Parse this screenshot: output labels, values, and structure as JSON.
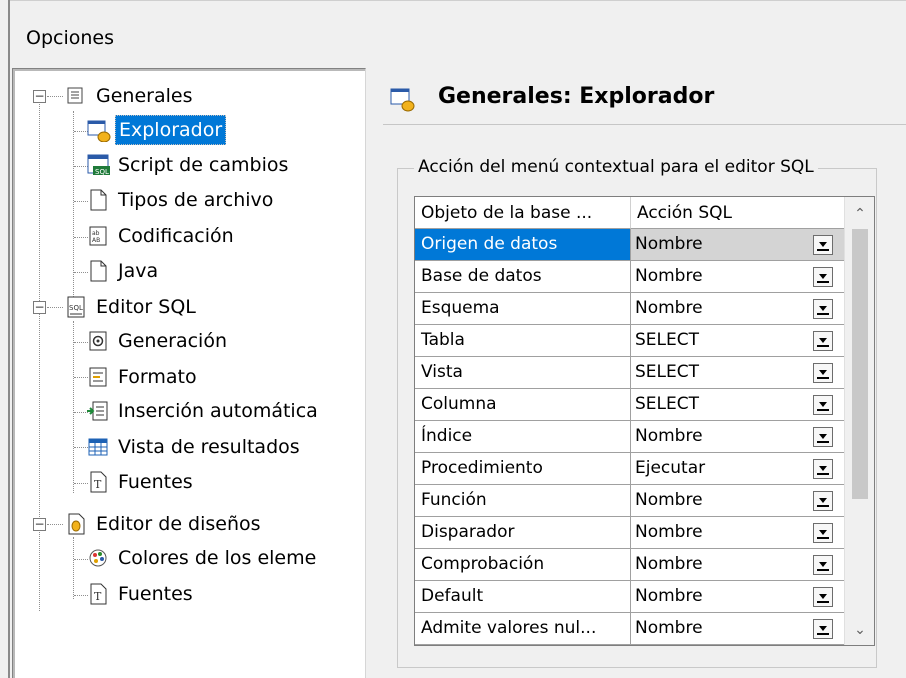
{
  "window": {
    "title": "Opciones"
  },
  "tree": {
    "nodes": [
      {
        "label": "Generales",
        "icon": "window-icon",
        "level": 0,
        "expanded": true,
        "selected": false
      },
      {
        "label": "Explorador",
        "icon": "explorer-db-icon",
        "level": 1,
        "selected": true
      },
      {
        "label": "Script de cambios",
        "icon": "sql-script-icon",
        "level": 1,
        "selected": false
      },
      {
        "label": "Tipos de archivo",
        "icon": "file-icon",
        "level": 1,
        "selected": false
      },
      {
        "label": "Codificación",
        "icon": "encoding-icon",
        "level": 1,
        "selected": false
      },
      {
        "label": "Java",
        "icon": "file-icon",
        "level": 1,
        "selected": false
      },
      {
        "label": "Editor SQL",
        "icon": "sql-editor-icon",
        "level": 0,
        "expanded": true,
        "selected": false
      },
      {
        "label": "Generación",
        "icon": "gear-doc-icon",
        "level": 1,
        "selected": false
      },
      {
        "label": "Formato",
        "icon": "format-icon",
        "level": 1,
        "selected": false
      },
      {
        "label": "Inserción automática",
        "icon": "insert-icon",
        "level": 1,
        "selected": false
      },
      {
        "label": "Vista de resultados",
        "icon": "table-grid-icon",
        "level": 1,
        "selected": false
      },
      {
        "label": "Fuentes",
        "icon": "font-icon",
        "level": 1,
        "selected": false
      },
      {
        "label": "Editor de diseños",
        "icon": "design-editor-icon",
        "level": 0,
        "expanded": true,
        "selected": false
      },
      {
        "label": "Colores de los eleme",
        "icon": "palette-icon",
        "level": 1,
        "selected": false
      },
      {
        "label": "Fuentes",
        "icon": "font-icon",
        "level": 1,
        "selected": false
      }
    ]
  },
  "content": {
    "title": "Generales: Explorador",
    "group_label": "Acción del menú contextual para el editor SQL",
    "grid": {
      "headers": [
        "Objeto de la base ...",
        "Acción SQL"
      ],
      "rows": [
        {
          "object": "Origen de datos",
          "action": "Nombre",
          "selected": true
        },
        {
          "object": "Base de datos",
          "action": "Nombre"
        },
        {
          "object": "Esquema",
          "action": "Nombre"
        },
        {
          "object": "Tabla",
          "action": "SELECT"
        },
        {
          "object": "Vista",
          "action": "SELECT"
        },
        {
          "object": "Columna",
          "action": "SELECT"
        },
        {
          "object": "Índice",
          "action": "Nombre"
        },
        {
          "object": "Procedimiento",
          "action": "Ejecutar"
        },
        {
          "object": "Función",
          "action": "Nombre"
        },
        {
          "object": "Disparador",
          "action": "Nombre"
        },
        {
          "object": "Comprobación",
          "action": "Nombre"
        },
        {
          "object": "Default",
          "action": "Nombre"
        },
        {
          "object": "Admite valores nul...",
          "action": "Nombre"
        }
      ]
    }
  },
  "colors": {
    "selection": "#0078d7",
    "background": "#f0f0f0"
  }
}
